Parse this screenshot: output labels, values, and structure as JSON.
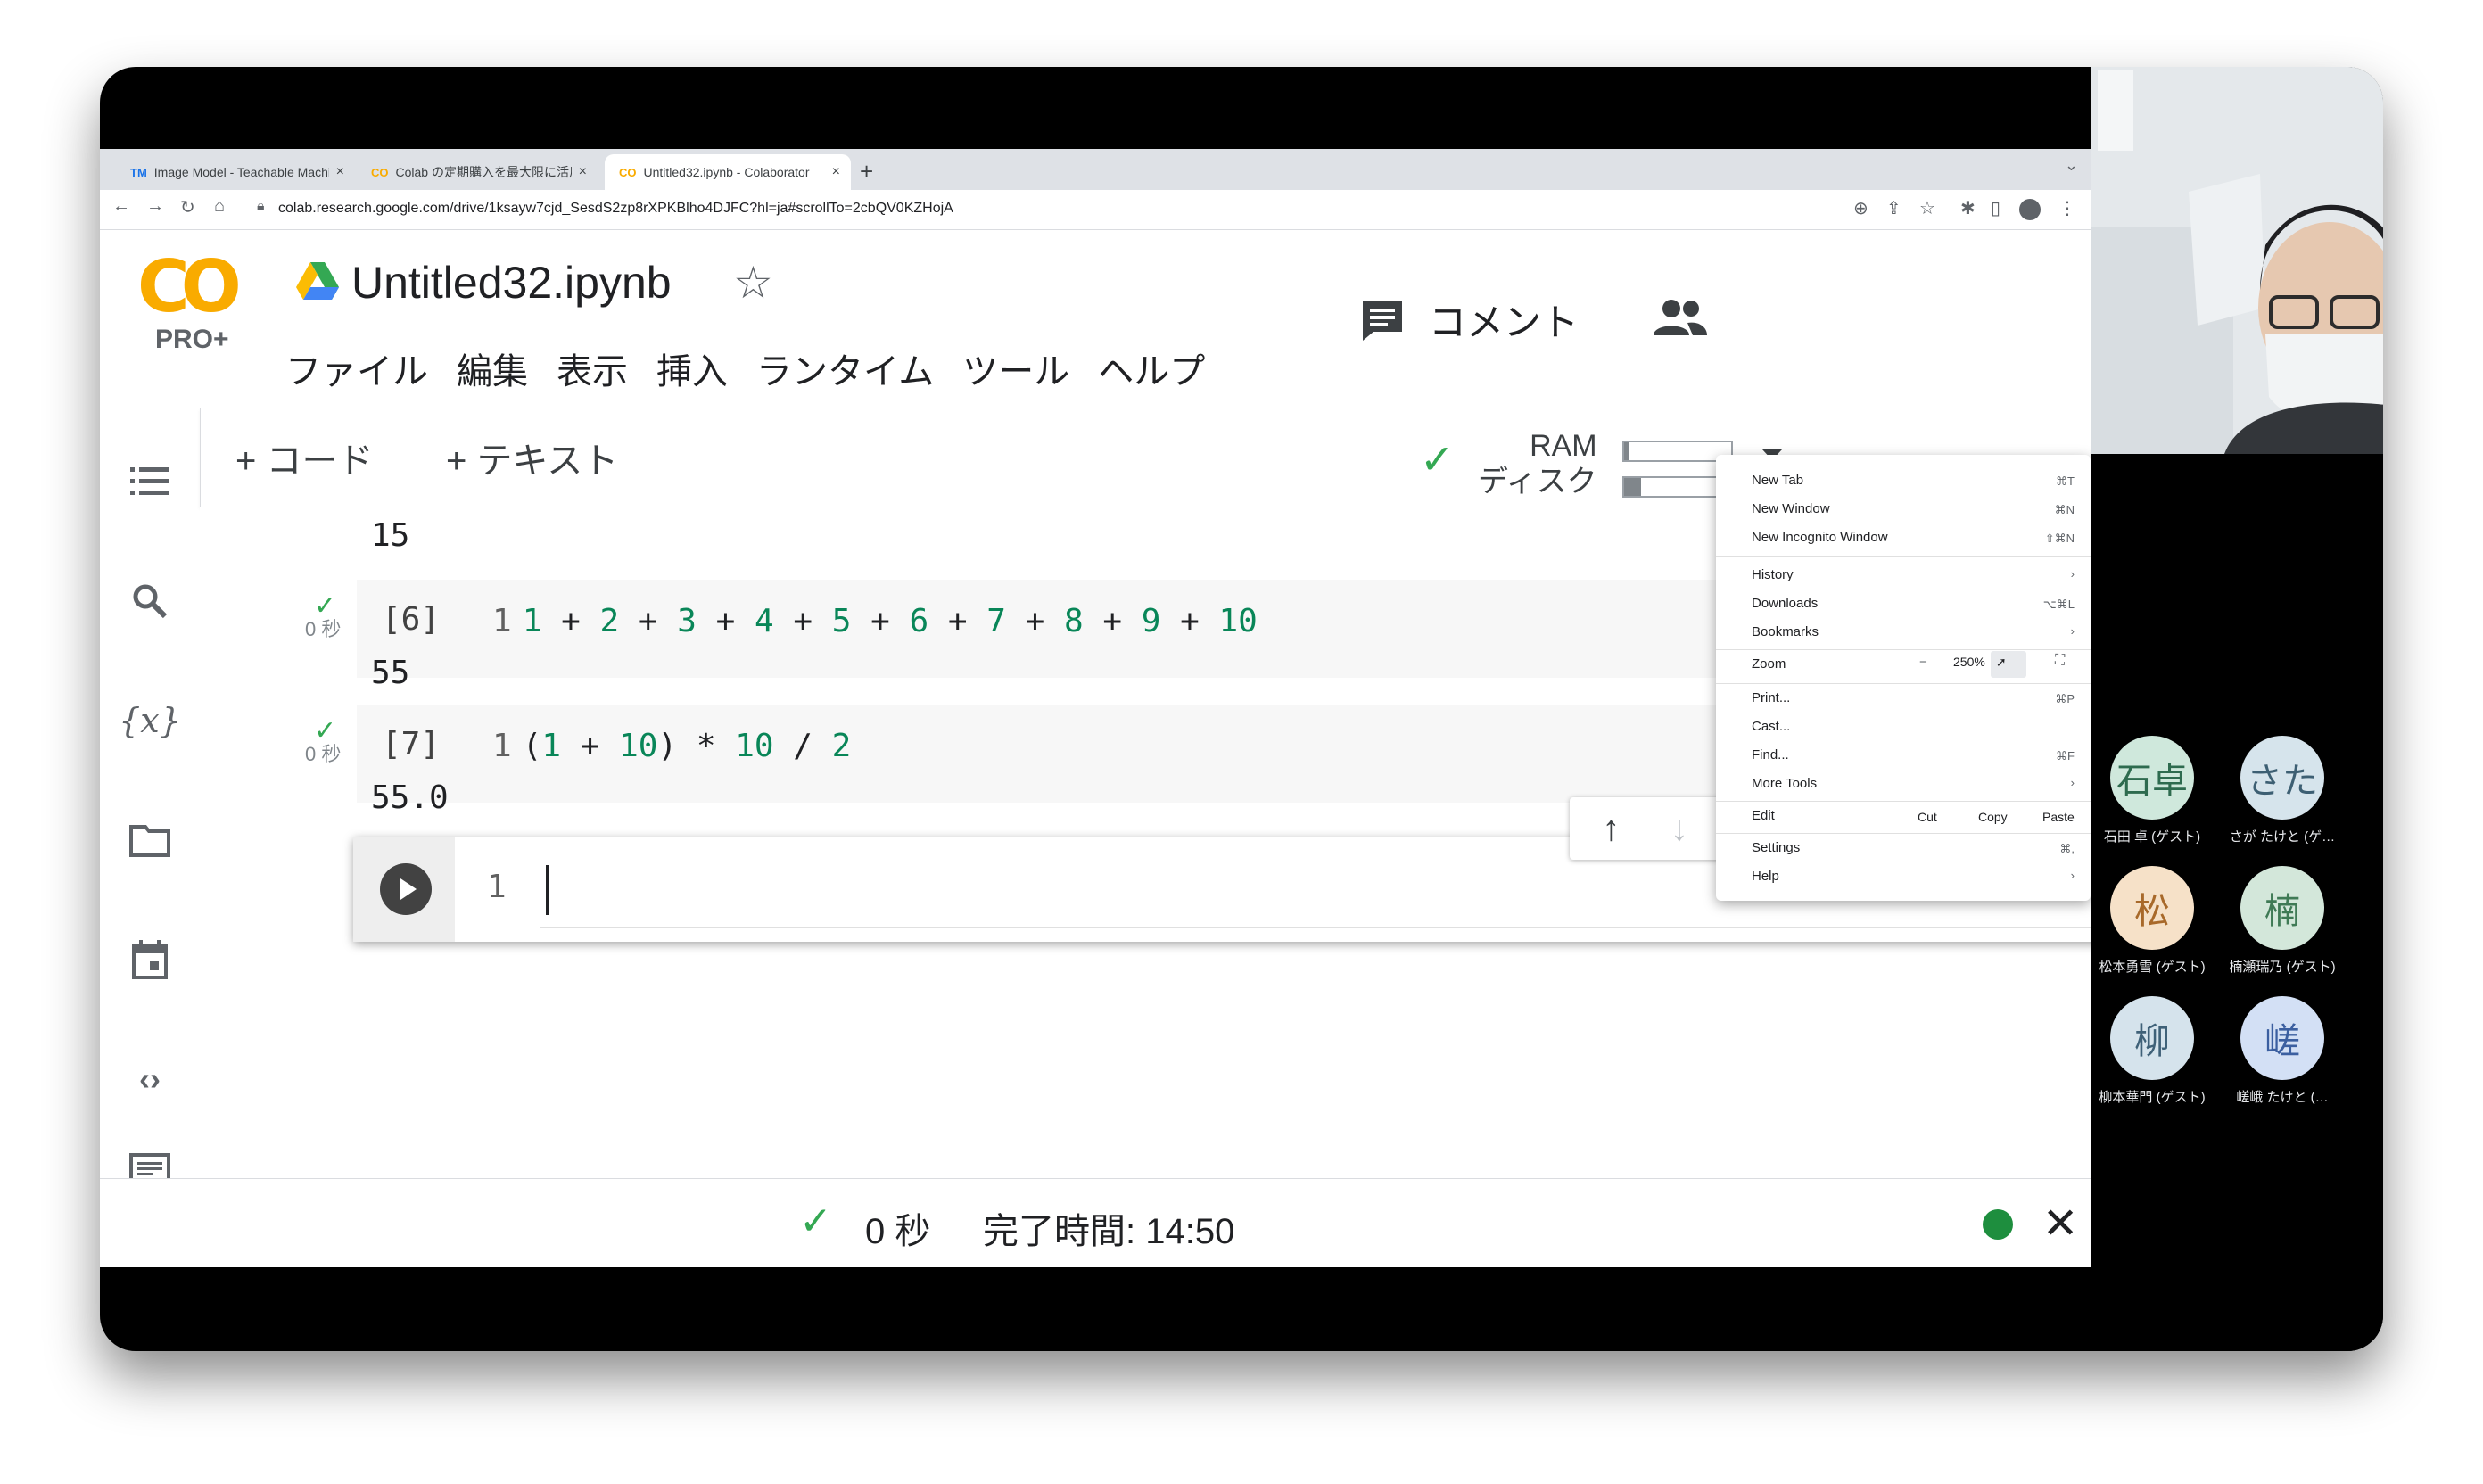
{
  "browser": {
    "tabs": [
      {
        "favicon": "TM",
        "label": "Image Model - Teachable Machi",
        "close": "×"
      },
      {
        "favicon": "CO",
        "label": "Colab の定期購入を最大限に活用",
        "close": "×"
      },
      {
        "favicon": "CO",
        "label": "Untitled32.ipynb - Colaborator",
        "close": "×"
      }
    ],
    "new_tab": "+",
    "url": "colab.research.google.com/drive/1ksayw7cjd_SesdS2zp8rXPKBlho4DJFC?hl=ja#scrollTo=2cbQV0KZHojA"
  },
  "colab": {
    "logo": "CO",
    "plan": "PRO+",
    "title": "Untitled32.ipynb",
    "menu": [
      "ファイル",
      "編集",
      "表示",
      "挿入",
      "ランタイム",
      "ツール",
      "ヘルプ"
    ],
    "comment_label": "コメント",
    "add_code": "+ コード",
    "add_text": "+ テキスト",
    "ram_label": "RAM",
    "disk_label": "ディスク",
    "ram_usage": 0.04,
    "disk_usage": 0.16
  },
  "notebook": {
    "output_prev": "15",
    "cell6": {
      "exec": "[6]",
      "time": "0 秒",
      "line": "1",
      "output": "55"
    },
    "cell7": {
      "exec": "[7]",
      "time": "0 秒",
      "line": "1",
      "output": "55.0"
    },
    "active_line": "1"
  },
  "status": {
    "elapsed": "0 秒",
    "completed": "完了時間: 14:50"
  },
  "chrome_menu": {
    "items": [
      {
        "label": "New Tab",
        "shortcut": "⌘T"
      },
      {
        "label": "New Window",
        "shortcut": "⌘N"
      },
      {
        "label": "New Incognito Window",
        "shortcut": "⇧⌘N"
      },
      {
        "label": "History",
        "shortcut": "›"
      },
      {
        "label": "Downloads",
        "shortcut": "⌥⌘L"
      },
      {
        "label": "Bookmarks",
        "shortcut": "›"
      },
      {
        "label": "Print...",
        "shortcut": "⌘P"
      },
      {
        "label": "Cast...",
        "shortcut": ""
      },
      {
        "label": "Find...",
        "shortcut": "⌘F"
      },
      {
        "label": "More Tools",
        "shortcut": "›"
      },
      {
        "label": "Settings",
        "shortcut": "⌘,"
      },
      {
        "label": "Help",
        "shortcut": "›"
      }
    ],
    "zoom_label": "Zoom",
    "zoom_minus": "−",
    "zoom_value": "250%",
    "edit_label": "Edit",
    "cut": "Cut",
    "copy": "Copy",
    "paste": "Paste"
  },
  "participants": [
    {
      "initials": "石卓",
      "name": "石田 卓 (ゲスト)",
      "bg": "#cfe8dc",
      "fg": "#2e6b4f"
    },
    {
      "initials": "さた",
      "name": "さが たけと (ゲ…",
      "bg": "#d6e4ec",
      "fg": "#3d5f73"
    },
    {
      "initials": "松",
      "name": "松本勇雪 (ゲスト)",
      "bg": "#f6e1c8",
      "fg": "#a8692a"
    },
    {
      "initials": "楠",
      "name": "楠瀬瑞乃 (ゲスト)",
      "bg": "#d3e7da",
      "fg": "#3f7a55"
    },
    {
      "initials": "柳",
      "name": "柳本華門 (ゲスト)",
      "bg": "#d5e3ec",
      "fg": "#3f6178"
    },
    {
      "initials": "嵯",
      "name": "嵯峨 たけと (…",
      "bg": "#d3e0f5",
      "fg": "#3b5fa0"
    }
  ],
  "colors": {
    "accent_green": "#34a853",
    "number_green": "#098658",
    "logo_orange": "#f9ab00"
  }
}
